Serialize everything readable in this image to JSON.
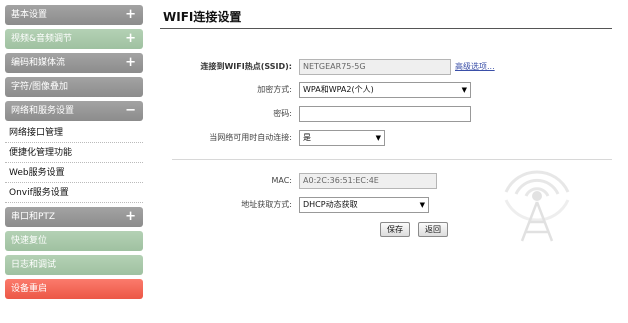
{
  "sidebar": {
    "items": [
      {
        "label": "基本设置",
        "toggle": "+",
        "style": "gray"
      },
      {
        "label": "视频&音频调节",
        "toggle": "+",
        "style": "green"
      },
      {
        "label": "编码和媒体流",
        "toggle": "+",
        "style": "gray"
      },
      {
        "label": "字符/图像叠加",
        "toggle": "",
        "style": "gray"
      },
      {
        "label": "网络和服务设置",
        "toggle": "−",
        "style": "gray"
      }
    ],
    "sub_items": [
      "网络接口管理",
      "便捷化管理功能",
      "Web服务设置",
      "Onvif服务设置"
    ],
    "items_after": [
      {
        "label": "串口和PTZ",
        "toggle": "+",
        "style": "gray"
      },
      {
        "label": "快速复位",
        "toggle": "",
        "style": "green"
      },
      {
        "label": "日志和调试",
        "toggle": "",
        "style": "green"
      },
      {
        "label": "设备重启",
        "toggle": "",
        "style": "red"
      }
    ]
  },
  "main": {
    "title": "WIFI连接设置",
    "ssid": {
      "label": "连接到WIFI热点(SSID):",
      "value": "NETGEAR75-5G",
      "advanced_link": "高级选项..."
    },
    "encryption": {
      "label": "加密方式:",
      "value": "WPA和WPA2(个人)"
    },
    "password": {
      "label": "密码:",
      "value": ""
    },
    "auto_connect": {
      "label": "当网络可用时自动连接:",
      "value": "是"
    },
    "mac": {
      "label": "MAC:",
      "value": "A0:2C:36:51:EC:4E"
    },
    "address_mode": {
      "label": "地址获取方式:",
      "value": "DHCP动态获取"
    },
    "save_label": "保存",
    "back_label": "返回"
  },
  "icons": {
    "background": "wifi-tower-icon",
    "dropdown": "chevron-down-icon"
  },
  "colors": {
    "gray_button": "#9a9a9a",
    "green_button": "#a9c8aa",
    "red_button": "#f26452",
    "link": "#3a4fa8"
  }
}
